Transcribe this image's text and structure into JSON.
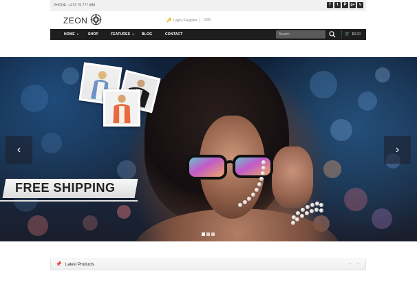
{
  "topbar": {
    "phone": "PHONE: +373 79 777 888",
    "social": [
      {
        "icon": "facebook-icon",
        "glyph": "f"
      },
      {
        "icon": "twitter-icon",
        "glyph": "t"
      },
      {
        "icon": "pinterest-icon",
        "glyph": "P"
      },
      {
        "icon": "google-plus-icon",
        "glyph": "g+"
      },
      {
        "icon": "vimeo-icon",
        "glyph": "v"
      }
    ]
  },
  "header": {
    "logo": "ZEON",
    "login": "Login / Register",
    "currency": "USD"
  },
  "nav": {
    "items": [
      {
        "label": "HOME",
        "has_caret": true
      },
      {
        "label": "SHOP",
        "has_caret": false
      },
      {
        "label": "FEATURES",
        "has_caret": true
      },
      {
        "label": "BLOG",
        "has_caret": false
      },
      {
        "label": "CONTACT",
        "has_caret": false
      }
    ],
    "search_placeholder": "Search",
    "cart_total": "$0.00"
  },
  "slider": {
    "caption": "FREE SHIPPING",
    "prev_arrow": "‹",
    "next_arrow": "›",
    "slide_count": 3,
    "active_slide": 1
  },
  "latest": {
    "title": "Latest Products",
    "prev": "←",
    "next": "→"
  },
  "colors": {
    "nav_bg": "#1e1e1e",
    "topbar_bg": "#f1f1f1"
  }
}
